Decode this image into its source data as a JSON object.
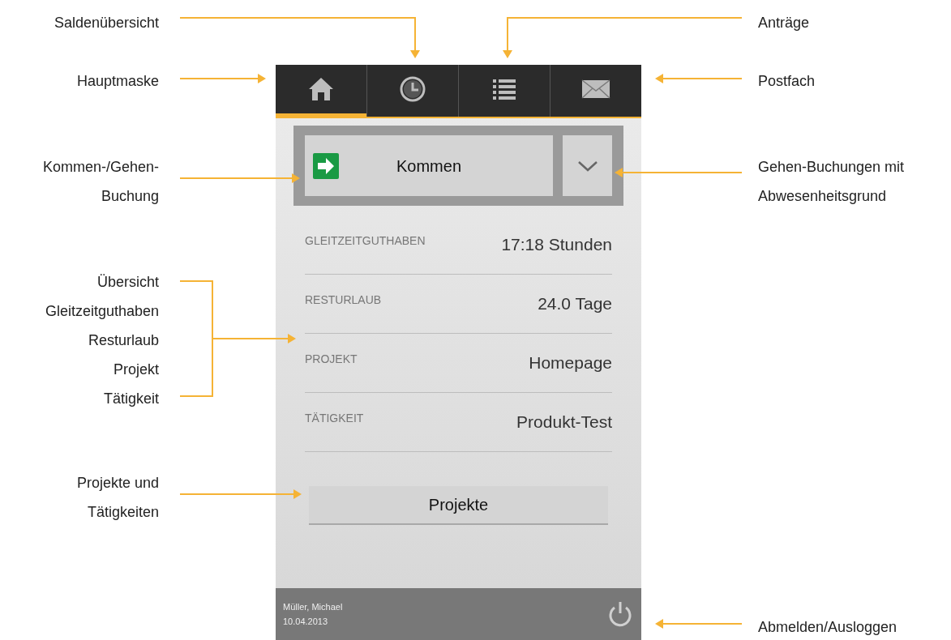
{
  "tabs": [
    {
      "kind": "home",
      "selected": true
    },
    {
      "kind": "clock",
      "selected": false
    },
    {
      "kind": "list",
      "selected": false
    },
    {
      "kind": "mail",
      "selected": false
    }
  ],
  "booking": {
    "label": "Kommen"
  },
  "balances": [
    {
      "label": "GLEITZEITGUTHABEN",
      "value": "17:18 Stunden"
    },
    {
      "label": "RESTURLAUB",
      "value": "24.0 Tage"
    },
    {
      "label": "PROJEKT",
      "value": "Homepage"
    },
    {
      "label": "TÄTIGKEIT",
      "value": "Produkt-Test"
    }
  ],
  "projects_button": "Projekte",
  "footer": {
    "user": "Müller, Michael",
    "date": "10.04.2013"
  },
  "annotations": [
    {
      "kind": "left",
      "lines": [
        "Saldenübersicht"
      ]
    },
    {
      "kind": "right",
      "lines": [
        "Anträge"
      ]
    },
    {
      "kind": "left",
      "lines": [
        "Hauptmaske"
      ]
    },
    {
      "kind": "right",
      "lines": [
        "Postfach"
      ]
    },
    {
      "kind": "left",
      "lines": [
        "Kommen-/Gehen-",
        "Buchung"
      ]
    },
    {
      "kind": "right",
      "lines": [
        "Gehen-Buchungen mit",
        "Abwesenheitsgrund"
      ]
    },
    {
      "kind": "left",
      "lines": [
        "Übersicht",
        "Gleitzeitguthaben",
        "Resturlaub",
        "Projekt",
        "Tätigkeit"
      ]
    },
    {
      "kind": "left",
      "lines": [
        "Projekte und",
        "Tätigkeiten"
      ]
    },
    {
      "kind": "right",
      "lines": [
        "Abmelden/Ausloggen"
      ]
    }
  ]
}
